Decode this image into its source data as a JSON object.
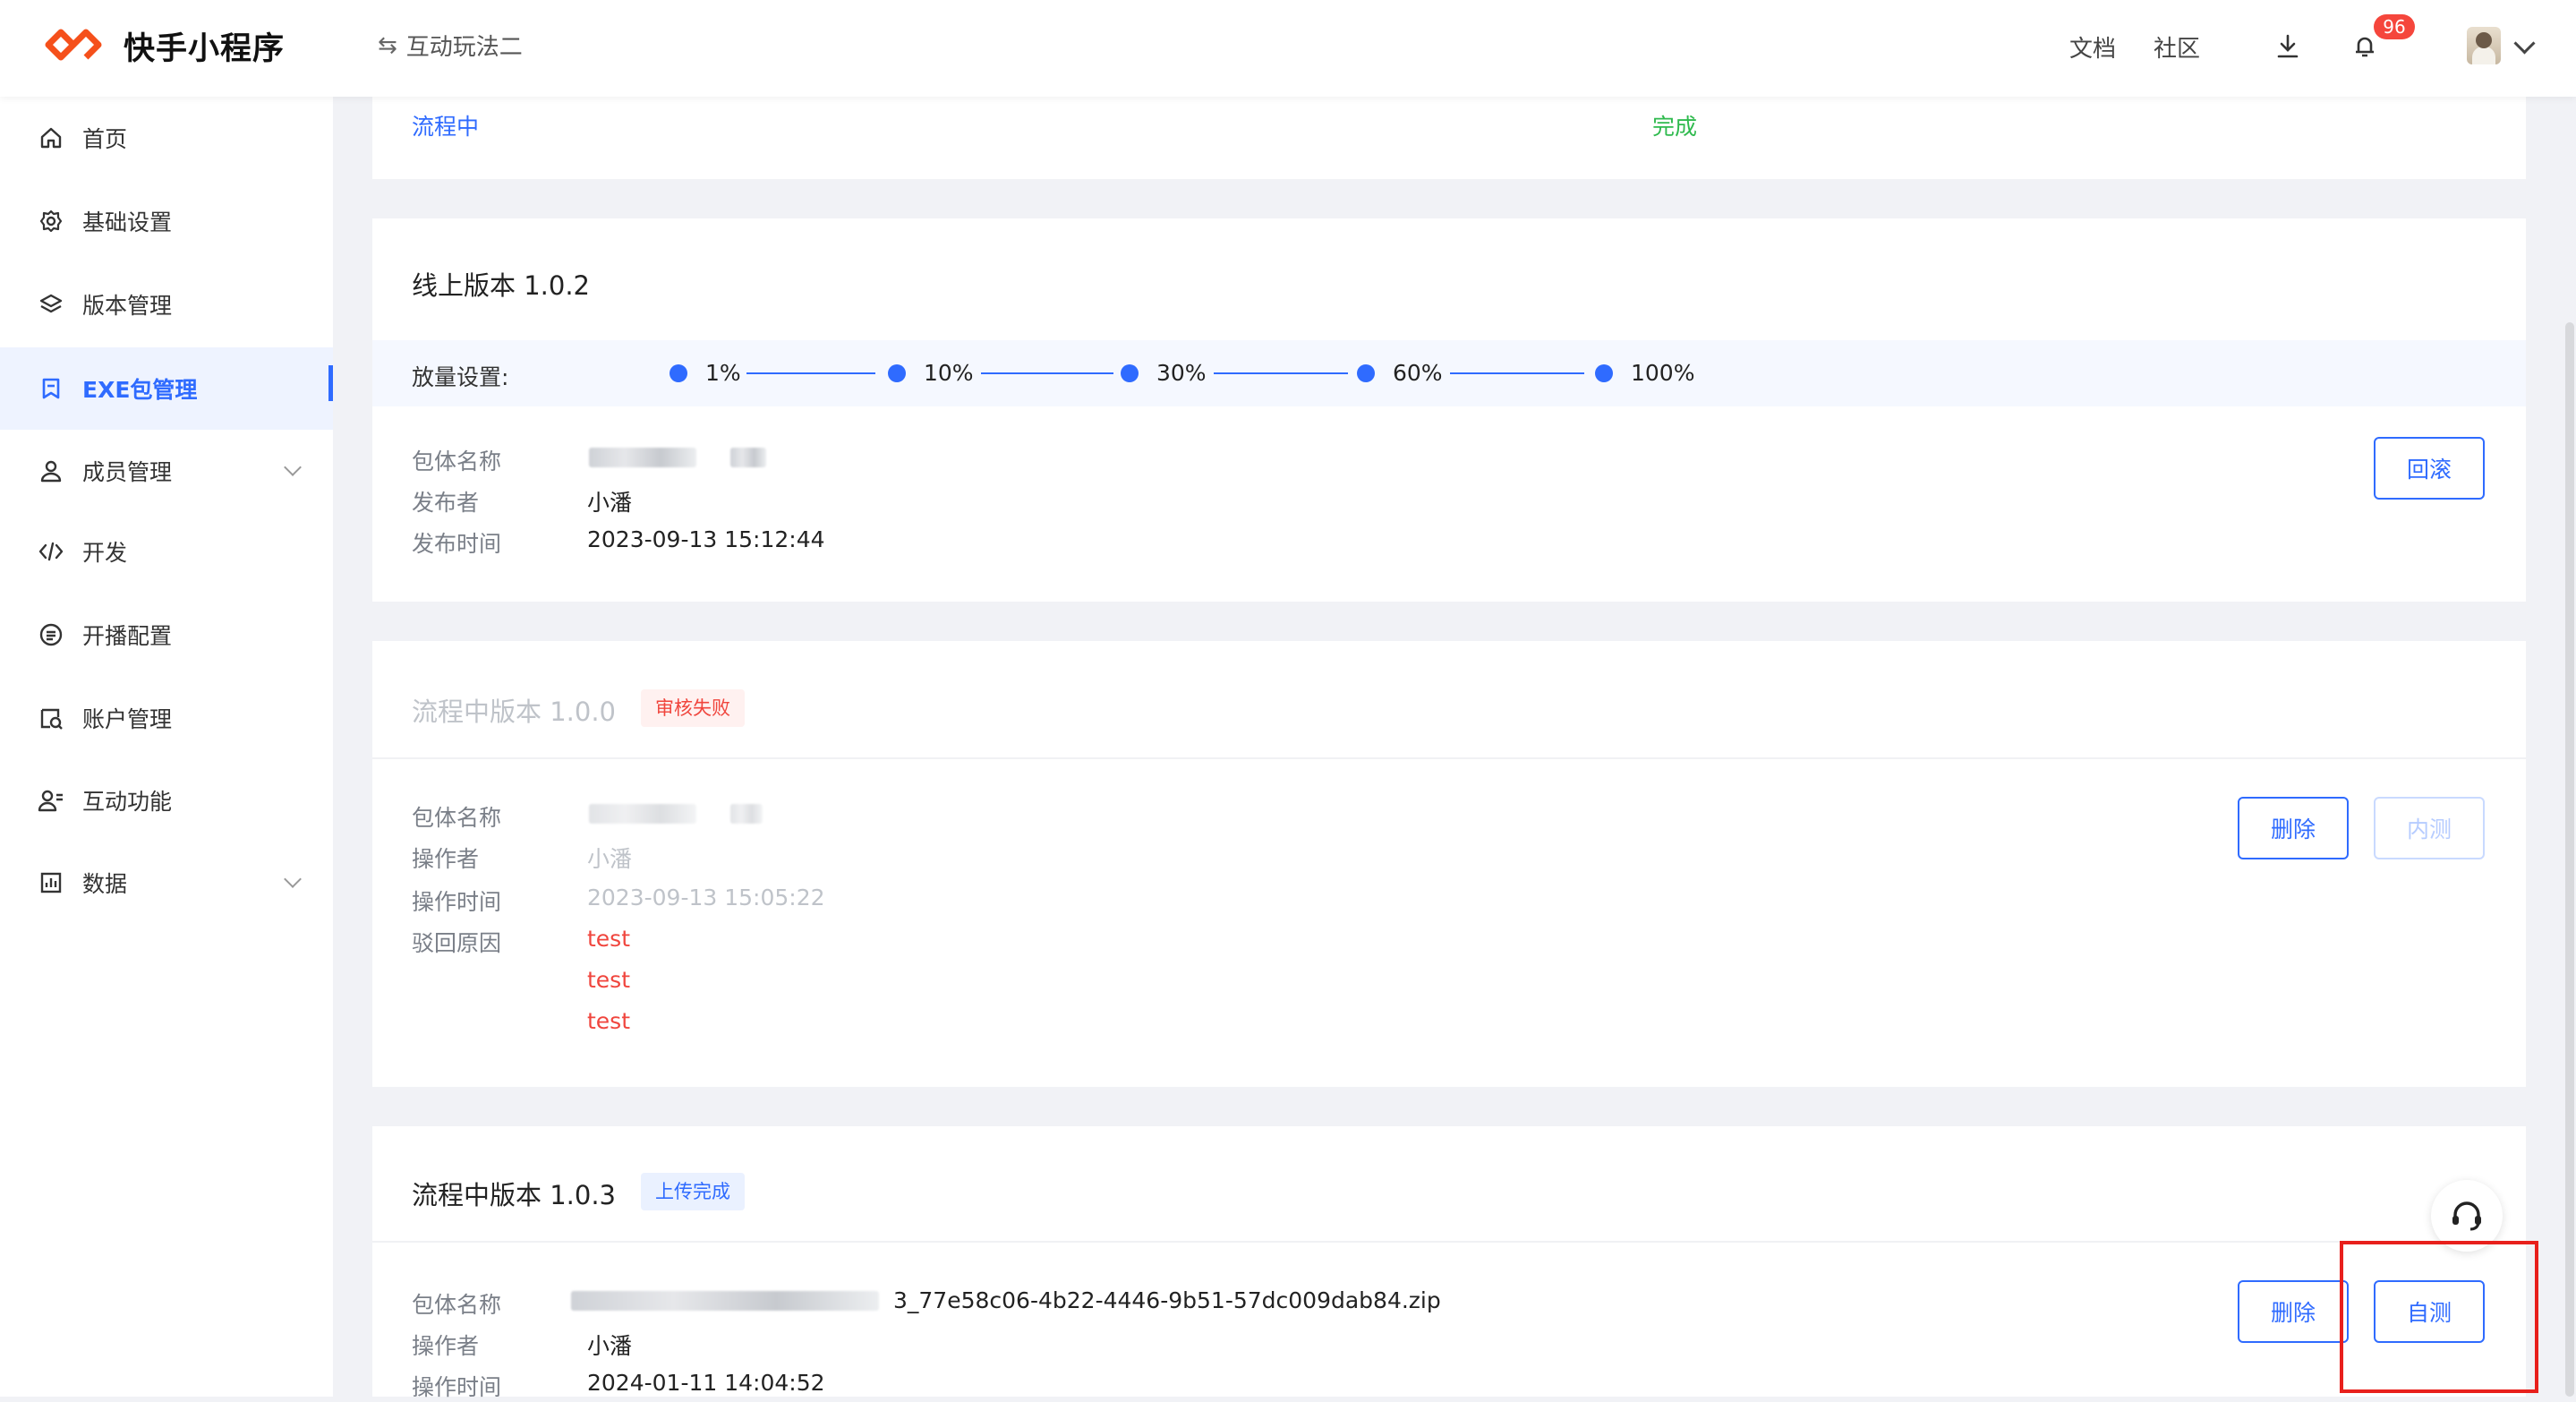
{
  "header": {
    "brand": "快手小程序",
    "project": "互动玩法二",
    "links": {
      "docs": "文档",
      "community": "社区"
    },
    "notification_count": "96",
    "accent": "#2f6bff"
  },
  "sidebar": {
    "items": [
      {
        "label": "首页",
        "icon": "home-icon"
      },
      {
        "label": "基础设置",
        "icon": "gear-icon"
      },
      {
        "label": "版本管理",
        "icon": "layers-icon"
      },
      {
        "label": "EXE包管理",
        "icon": "package-icon",
        "active": true
      },
      {
        "label": "成员管理",
        "icon": "user-icon",
        "expandable": true
      },
      {
        "label": "开发",
        "icon": "code-icon"
      },
      {
        "label": "开播配置",
        "icon": "broadcast-icon"
      },
      {
        "label": "账户管理",
        "icon": "account-icon"
      },
      {
        "label": "互动功能",
        "icon": "interaction-icon"
      },
      {
        "label": "数据",
        "icon": "chart-icon",
        "expandable": true
      }
    ]
  },
  "top_card": {
    "left": "流程中",
    "right": "完成"
  },
  "online_card": {
    "title": "线上版本 1.0.2",
    "rollout_label": "放量设置:",
    "steps": [
      "1%",
      "10%",
      "30%",
      "60%",
      "100%"
    ],
    "labels": {
      "package": "包体名称",
      "publisher": "发布者",
      "time": "发布时间"
    },
    "publisher": "小潘",
    "time": "2023-09-13 15:12:44",
    "rollback_button": "回滚"
  },
  "failed_card": {
    "title": "流程中版本 1.0.0",
    "status": "审核失败",
    "labels": {
      "package": "包体名称",
      "operator": "操作者",
      "time": "操作时间",
      "reason": "驳回原因"
    },
    "operator": "小潘",
    "time": "2023-09-13 15:05:22",
    "reasons": [
      "test",
      "test",
      "test"
    ],
    "delete_button": "删除",
    "internal_test_button": "内测"
  },
  "uploaded_card": {
    "title": "流程中版本 1.0.3",
    "status": "上传完成",
    "labels": {
      "package": "包体名称",
      "operator": "操作者",
      "time": "操作时间"
    },
    "package_suffix": "3_77e58c06-4b22-4446-9b51-57dc009dab84.zip",
    "operator": "小潘",
    "time": "2024-01-11 14:04:52",
    "delete_button": "删除",
    "self_test_button": "自测"
  }
}
